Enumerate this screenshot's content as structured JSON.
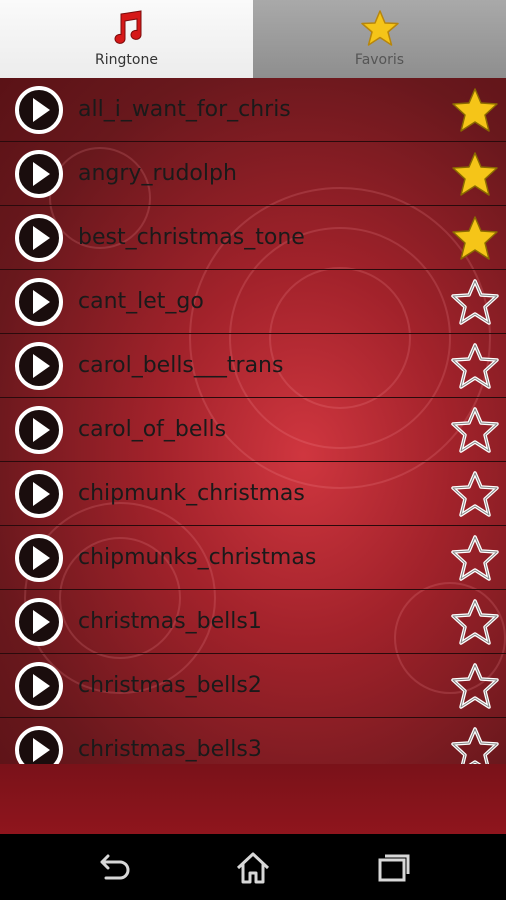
{
  "tabs": [
    {
      "label": "Ringtone",
      "icon": "music-note-icon",
      "active": true
    },
    {
      "label": "Favoris",
      "icon": "star-icon",
      "active": false
    }
  ],
  "ringtones": [
    {
      "title": "all_i_want_for_chris",
      "favorite": true
    },
    {
      "title": "angry_rudolph",
      "favorite": true
    },
    {
      "title": "best_christmas_tone",
      "favorite": true
    },
    {
      "title": "cant_let_go",
      "favorite": false
    },
    {
      "title": "carol_bells___trans",
      "favorite": false
    },
    {
      "title": "carol_of_bells",
      "favorite": false
    },
    {
      "title": "chipmunk_christmas",
      "favorite": false
    },
    {
      "title": "chipmunks_christmas",
      "favorite": false
    },
    {
      "title": "christmas_bells1",
      "favorite": false
    },
    {
      "title": "christmas_bells2",
      "favorite": false
    },
    {
      "title": "christmas_bells3",
      "favorite": false
    }
  ],
  "nav": {
    "back_icon": "back-icon",
    "home_icon": "home-icon",
    "recents_icon": "recent-apps-icon"
  },
  "colors": {
    "star_fill": "#f5c518",
    "row_divider": "#2a0a0c",
    "background_red": "#c8323b"
  }
}
